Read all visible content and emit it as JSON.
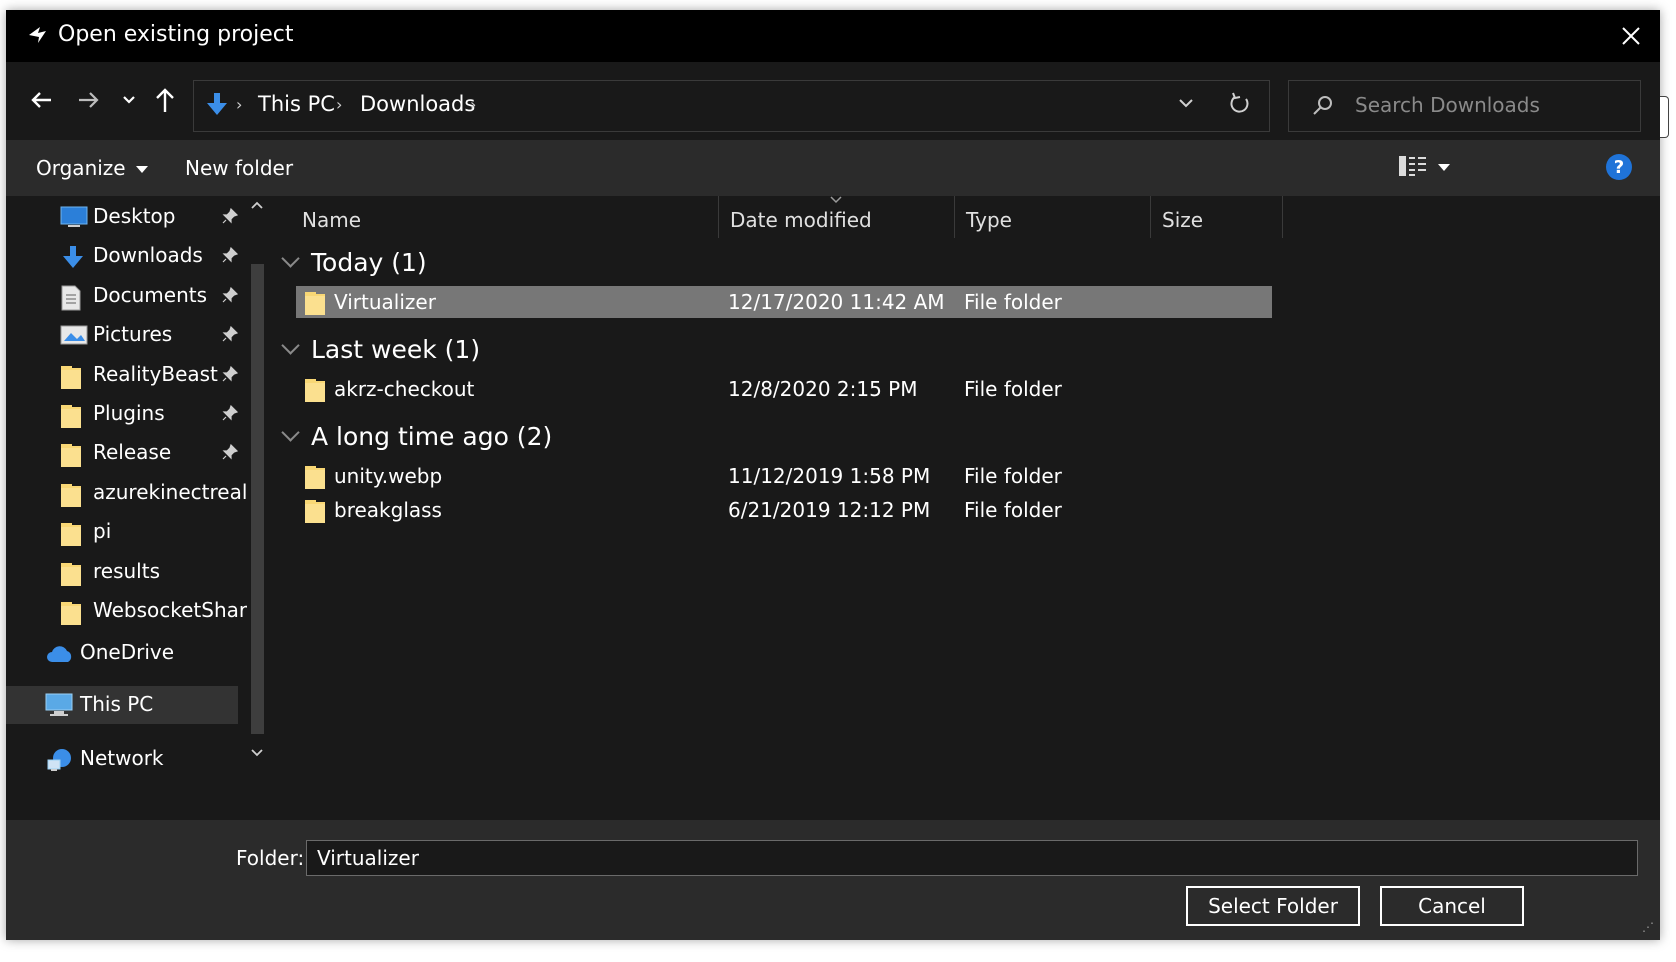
{
  "window": {
    "title": "Open existing project"
  },
  "address": {
    "crumbs": [
      "This PC",
      "Downloads"
    ]
  },
  "search": {
    "placeholder": "Search Downloads"
  },
  "toolbar": {
    "organize": "Organize",
    "new_folder": "New folder",
    "help": "?"
  },
  "nav_pane": {
    "quick_access": [
      {
        "label": "Desktop",
        "icon": "desktop-icon",
        "pinned": true
      },
      {
        "label": "Downloads",
        "icon": "download-arrow-icon",
        "pinned": true
      },
      {
        "label": "Documents",
        "icon": "document-icon",
        "pinned": true
      },
      {
        "label": "Pictures",
        "icon": "pictures-icon",
        "pinned": true
      },
      {
        "label": "RealityBeast",
        "icon": "folder-icon",
        "pinned": true
      },
      {
        "label": "Plugins",
        "icon": "folder-icon",
        "pinned": true
      },
      {
        "label": "Release",
        "icon": "folder-icon",
        "pinned": true
      },
      {
        "label": "azurekinectrealit",
        "icon": "folder-icon",
        "pinned": false
      },
      {
        "label": "pi",
        "icon": "folder-icon",
        "pinned": false
      },
      {
        "label": "results",
        "icon": "folder-icon",
        "pinned": false
      },
      {
        "label": "WebsocketSharp",
        "icon": "folder-icon",
        "pinned": false
      }
    ],
    "onedrive": "OneDrive",
    "this_pc": "This PC",
    "network": "Network"
  },
  "columns": {
    "name": "Name",
    "date": "Date modified",
    "type": "Type",
    "size": "Size"
  },
  "groups": [
    {
      "label": "Today (1)",
      "items": [
        {
          "name": "Virtualizer",
          "date": "12/17/2020 11:42 AM",
          "type": "File folder",
          "selected": true
        }
      ]
    },
    {
      "label": "Last week (1)",
      "items": [
        {
          "name": "akrz-checkout",
          "date": "12/8/2020 2:15 PM",
          "type": "File folder"
        }
      ]
    },
    {
      "label": "A long time ago (2)",
      "items": [
        {
          "name": "unity.webp",
          "date": "11/12/2019 1:58 PM",
          "type": "File folder"
        },
        {
          "name": "breakglass",
          "date": "6/21/2019 12:12 PM",
          "type": "File folder"
        }
      ]
    }
  ],
  "footer": {
    "folder_label": "Folder:",
    "folder_value": "Virtualizer",
    "select_button": "Select Folder",
    "cancel_button": "Cancel"
  },
  "colors": {
    "title_bg": "#000000",
    "window_bg": "#191919",
    "toolbar_bg": "#2b2b2b",
    "selection": "#777777",
    "accent_blue": "#1f73d8",
    "folder_yellow": "#f8d775"
  }
}
